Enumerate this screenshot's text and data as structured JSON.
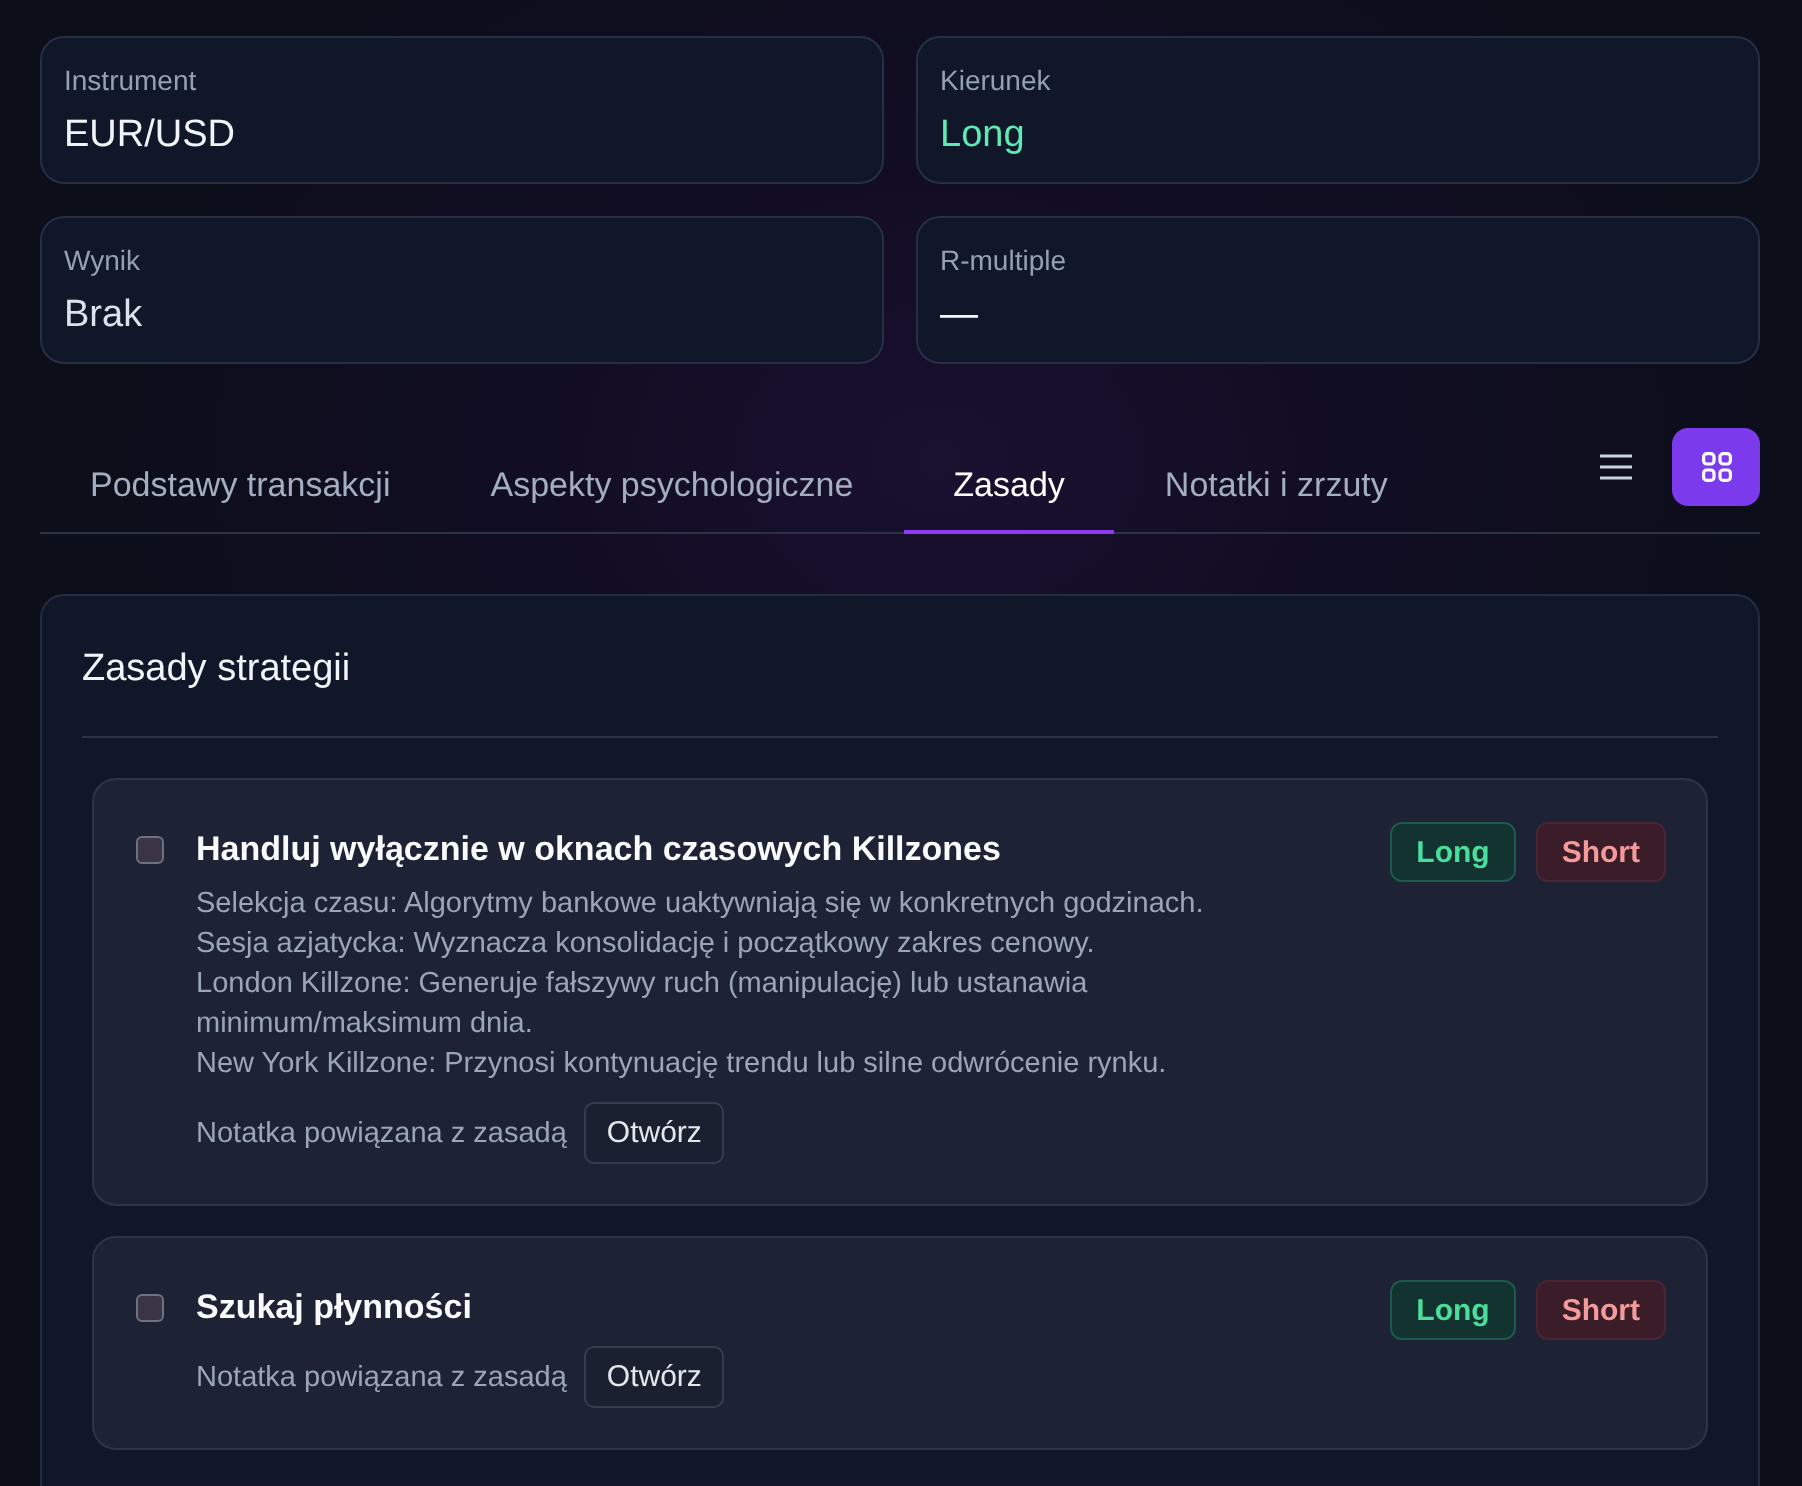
{
  "fields": [
    {
      "label": "Instrument",
      "value": "EUR/USD",
      "kind": "plain"
    },
    {
      "label": "Kierunek",
      "value": "Long",
      "kind": "long"
    },
    {
      "label": "Wynik",
      "value": "Brak",
      "kind": "muted"
    },
    {
      "label": "R-multiple",
      "value": "—",
      "kind": "plain"
    }
  ],
  "tabs": [
    {
      "label": "Podstawy transakcji",
      "selected": false
    },
    {
      "label": "Aspekty psychologiczne",
      "selected": false
    },
    {
      "label": "Zasady",
      "selected": true
    },
    {
      "label": "Notatki i zrzuty",
      "selected": false
    }
  ],
  "view_toggle": [
    {
      "kind": "list",
      "selected": false
    },
    {
      "kind": "grid",
      "selected": true
    }
  ],
  "rules_panel": {
    "title": "Zasady strategii",
    "rules": [
      {
        "title": "Handluj wyłącznie w oknach czasowych Killzones",
        "checked": false,
        "description": [
          "Selekcja czasu: Algorytmy bankowe uaktywniają się w konkretnych godzinach.",
          "Sesja azjatycka: Wyznacza konsolidację i początkowy zakres cenowy.",
          "London Killzone: Generuje fałszywy ruch (manipulację) lub ustanawia minimum/maksimum dnia.",
          "New York Killzone: Przynosi kontynuację trendu lub silne odwrócenie rynku."
        ],
        "badges": [
          {
            "label": "Long",
            "kind": "long"
          },
          {
            "label": "Short",
            "kind": "short"
          }
        ],
        "note_label": "Notatka powiązana z zasadą",
        "note_button": "Otwórz"
      },
      {
        "title": "Szukaj płynności",
        "checked": false,
        "badges": [
          {
            "label": "Long",
            "kind": "long"
          },
          {
            "label": "Short",
            "kind": "short"
          }
        ],
        "note_label": "Notatka powiązana z zasadą",
        "note_button": "Otwórz"
      }
    ]
  }
}
